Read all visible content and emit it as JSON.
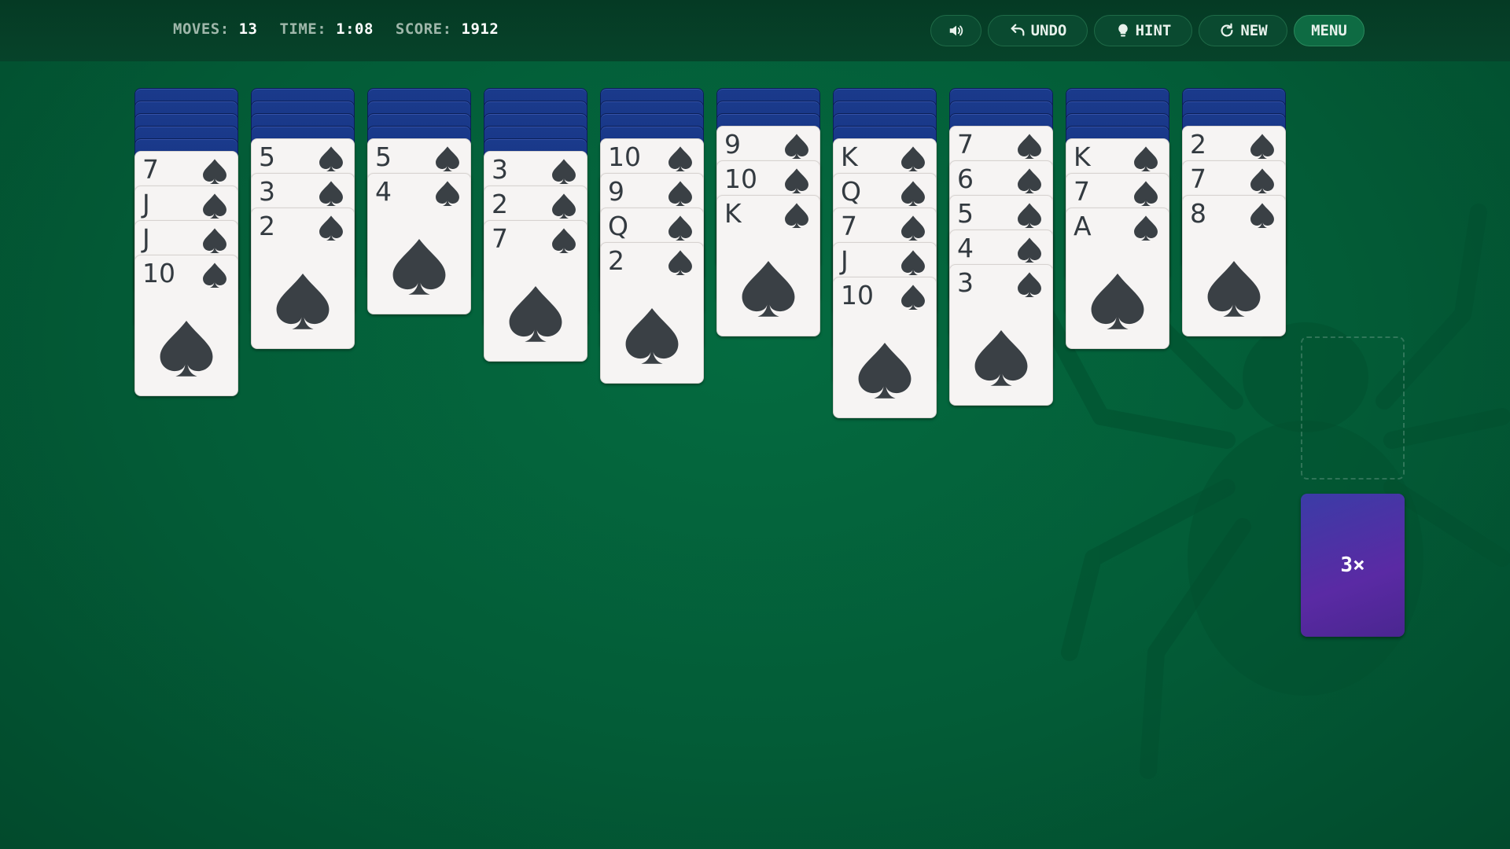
{
  "stats": {
    "moves_label": "MOVES:",
    "moves": "13",
    "time_label": "TIME:",
    "time": "1:08",
    "score_label": "SCORE:",
    "score": "1912"
  },
  "toolbar": {
    "sound_icon": "speaker-icon",
    "undo_label": "UNDO",
    "undo_icon": "undo-arrow-icon",
    "hint_label": "HINT",
    "hint_icon": "lightbulb-icon",
    "new_label": "NEW",
    "new_icon": "refresh-icon",
    "menu_label": "MENU"
  },
  "colors": {
    "felt": "#035c37",
    "card_back": "#1a3a8c",
    "card_face": "#f6f4f3",
    "suit": "#3a4045",
    "stock": "#5a2aa4"
  },
  "tableau": [
    {
      "facedown": 5,
      "cards": [
        "7",
        "J",
        "J",
        "10"
      ]
    },
    {
      "facedown": 4,
      "cards": [
        "5",
        "3",
        "2"
      ]
    },
    {
      "facedown": 4,
      "cards": [
        "5",
        "4"
      ]
    },
    {
      "facedown": 5,
      "cards": [
        "3",
        "2",
        "7"
      ]
    },
    {
      "facedown": 4,
      "cards": [
        "10",
        "9",
        "Q",
        "2"
      ]
    },
    {
      "facedown": 3,
      "cards": [
        "9",
        "10",
        "K"
      ]
    },
    {
      "facedown": 4,
      "cards": [
        "K",
        "Q",
        "7",
        "J",
        "10"
      ]
    },
    {
      "facedown": 3,
      "cards": [
        "7",
        "6",
        "5",
        "4",
        "3"
      ]
    },
    {
      "facedown": 4,
      "cards": [
        "K",
        "7",
        "A"
      ]
    },
    {
      "facedown": 3,
      "cards": [
        "2",
        "7",
        "8"
      ]
    }
  ],
  "suit": "spade-icon",
  "stock": {
    "label": "3×"
  }
}
